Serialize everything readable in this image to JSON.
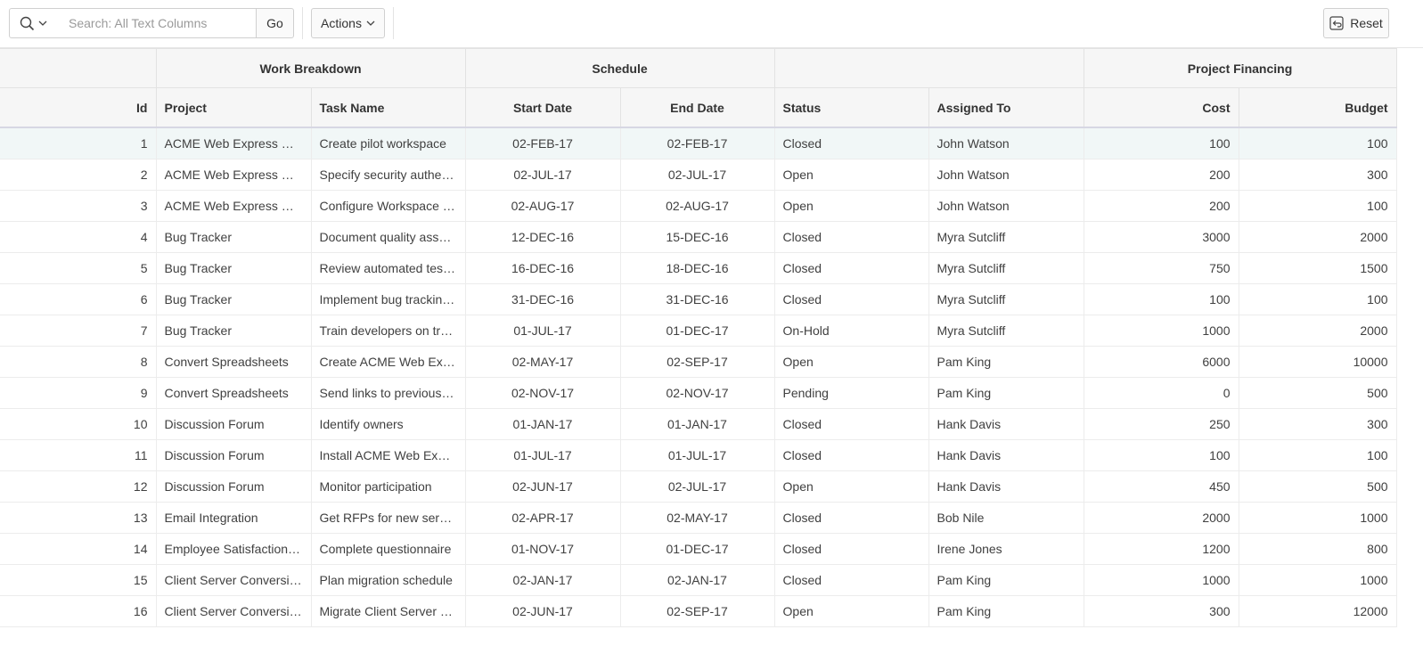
{
  "toolbar": {
    "search_placeholder": "Search: All Text Columns",
    "go_label": "Go",
    "actions_label": "Actions",
    "reset_label": "Reset"
  },
  "header": {
    "groups": {
      "work_breakdown": "Work Breakdown",
      "schedule": "Schedule",
      "status_group": "",
      "project_financing": "Project Financing"
    },
    "columns": {
      "id": "Id",
      "project": "Project",
      "task_name": "Task Name",
      "start_date": "Start Date",
      "end_date": "End Date",
      "status": "Status",
      "assigned_to": "Assigned To",
      "cost": "Cost",
      "budget": "Budget"
    }
  },
  "rows": [
    {
      "id": "1",
      "project": "ACME Web Express Conf…",
      "task": "Create pilot workspace",
      "start": "02-FEB-17",
      "end": "02-FEB-17",
      "status": "Closed",
      "assigned": "John Watson",
      "cost": "100",
      "budget": "100"
    },
    {
      "id": "2",
      "project": "ACME Web Express Conf…",
      "task": "Specify security authentic…",
      "start": "02-JUL-17",
      "end": "02-JUL-17",
      "status": "Open",
      "assigned": "John Watson",
      "cost": "200",
      "budget": "300"
    },
    {
      "id": "3",
      "project": "ACME Web Express Conf…",
      "task": "Configure Workspace pr…",
      "start": "02-AUG-17",
      "end": "02-AUG-17",
      "status": "Open",
      "assigned": "John Watson",
      "cost": "200",
      "budget": "100"
    },
    {
      "id": "4",
      "project": "Bug Tracker",
      "task": "Document quality assura…",
      "start": "12-DEC-16",
      "end": "15-DEC-16",
      "status": "Closed",
      "assigned": "Myra Sutcliff",
      "cost": "3000",
      "budget": "2000"
    },
    {
      "id": "5",
      "project": "Bug Tracker",
      "task": "Review automated testin…",
      "start": "16-DEC-16",
      "end": "18-DEC-16",
      "status": "Closed",
      "assigned": "Myra Sutcliff",
      "cost": "750",
      "budget": "1500"
    },
    {
      "id": "6",
      "project": "Bug Tracker",
      "task": "Implement bug tracking …",
      "start": "31-DEC-16",
      "end": "31-DEC-16",
      "status": "Closed",
      "assigned": "Myra Sutcliff",
      "cost": "100",
      "budget": "100"
    },
    {
      "id": "7",
      "project": "Bug Tracker",
      "task": "Train developers on track…",
      "start": "01-JUL-17",
      "end": "01-DEC-17",
      "status": "On-Hold",
      "assigned": "Myra Sutcliff",
      "cost": "1000",
      "budget": "2000"
    },
    {
      "id": "8",
      "project": "Convert Spreadsheets",
      "task": "Create ACME Web Expre…",
      "start": "02-MAY-17",
      "end": "02-SEP-17",
      "status": "Open",
      "assigned": "Pam King",
      "cost": "6000",
      "budget": "10000"
    },
    {
      "id": "9",
      "project": "Convert Spreadsheets",
      "task": "Send links to previous sp…",
      "start": "02-NOV-17",
      "end": "02-NOV-17",
      "status": "Pending",
      "assigned": "Pam King",
      "cost": "0",
      "budget": "500"
    },
    {
      "id": "10",
      "project": "Discussion Forum",
      "task": "Identify owners",
      "start": "01-JAN-17",
      "end": "01-JAN-17",
      "status": "Closed",
      "assigned": "Hank Davis",
      "cost": "250",
      "budget": "300"
    },
    {
      "id": "11",
      "project": "Discussion Forum",
      "task": "Install ACME Web Expres…",
      "start": "01-JUL-17",
      "end": "01-JUL-17",
      "status": "Closed",
      "assigned": "Hank Davis",
      "cost": "100",
      "budget": "100"
    },
    {
      "id": "12",
      "project": "Discussion Forum",
      "task": "Monitor participation",
      "start": "02-JUN-17",
      "end": "02-JUL-17",
      "status": "Open",
      "assigned": "Hank Davis",
      "cost": "450",
      "budget": "500"
    },
    {
      "id": "13",
      "project": "Email Integration",
      "task": "Get RFPs for new server",
      "start": "02-APR-17",
      "end": "02-MAY-17",
      "status": "Closed",
      "assigned": "Bob Nile",
      "cost": "2000",
      "budget": "1000"
    },
    {
      "id": "14",
      "project": "Employee Satisfaction Su…",
      "task": "Complete questionnaire",
      "start": "01-NOV-17",
      "end": "01-DEC-17",
      "status": "Closed",
      "assigned": "Irene Jones",
      "cost": "1200",
      "budget": "800"
    },
    {
      "id": "15",
      "project": "Client Server Conversion",
      "task": "Plan migration schedule",
      "start": "02-JAN-17",
      "end": "02-JAN-17",
      "status": "Closed",
      "assigned": "Pam King",
      "cost": "1000",
      "budget": "1000"
    },
    {
      "id": "16",
      "project": "Client Server Conversion",
      "task": "Migrate Client Server app…",
      "start": "02-JUN-17",
      "end": "02-SEP-17",
      "status": "Open",
      "assigned": "Pam King",
      "cost": "300",
      "budget": "12000"
    }
  ]
}
